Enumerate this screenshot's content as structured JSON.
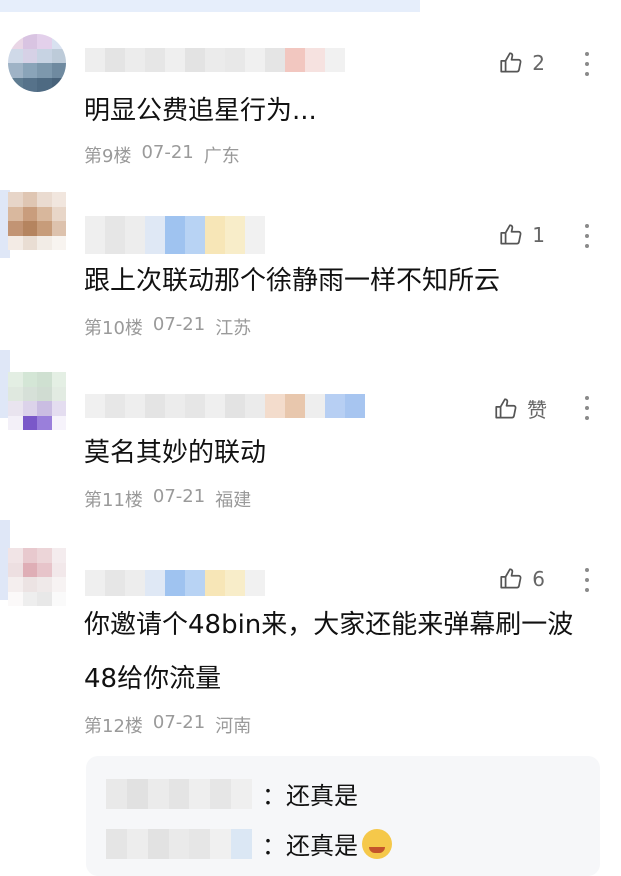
{
  "comments": [
    {
      "text": "明显公费追星行为...",
      "floor": "第9楼",
      "date": "07-21",
      "location": "广东",
      "likes": "2"
    },
    {
      "text": "跟上次联动那个徐静雨一样不知所云",
      "floor": "第10楼",
      "date": "07-21",
      "location": "江苏",
      "likes": "1"
    },
    {
      "text": "莫名其妙的联动",
      "floor": "第11楼",
      "date": "07-21",
      "location": "福建",
      "likes": "赞"
    },
    {
      "text": "你邀请个48bin来，大家还能来弹幕刷一波48给你流量",
      "floor": "第12楼",
      "date": "07-21",
      "location": "河南",
      "likes": "6",
      "replies": [
        {
          "text": "：还真是"
        },
        {
          "text": "：还真是"
        }
      ]
    }
  ],
  "icons": {
    "like": "thumbs-up-icon",
    "more": "more-vertical-icon",
    "emoji": "grin-emoji-icon"
  },
  "colors": {
    "meta": "#9a9a9a",
    "text": "#111111",
    "reply_bg": "#f6f7f9"
  }
}
